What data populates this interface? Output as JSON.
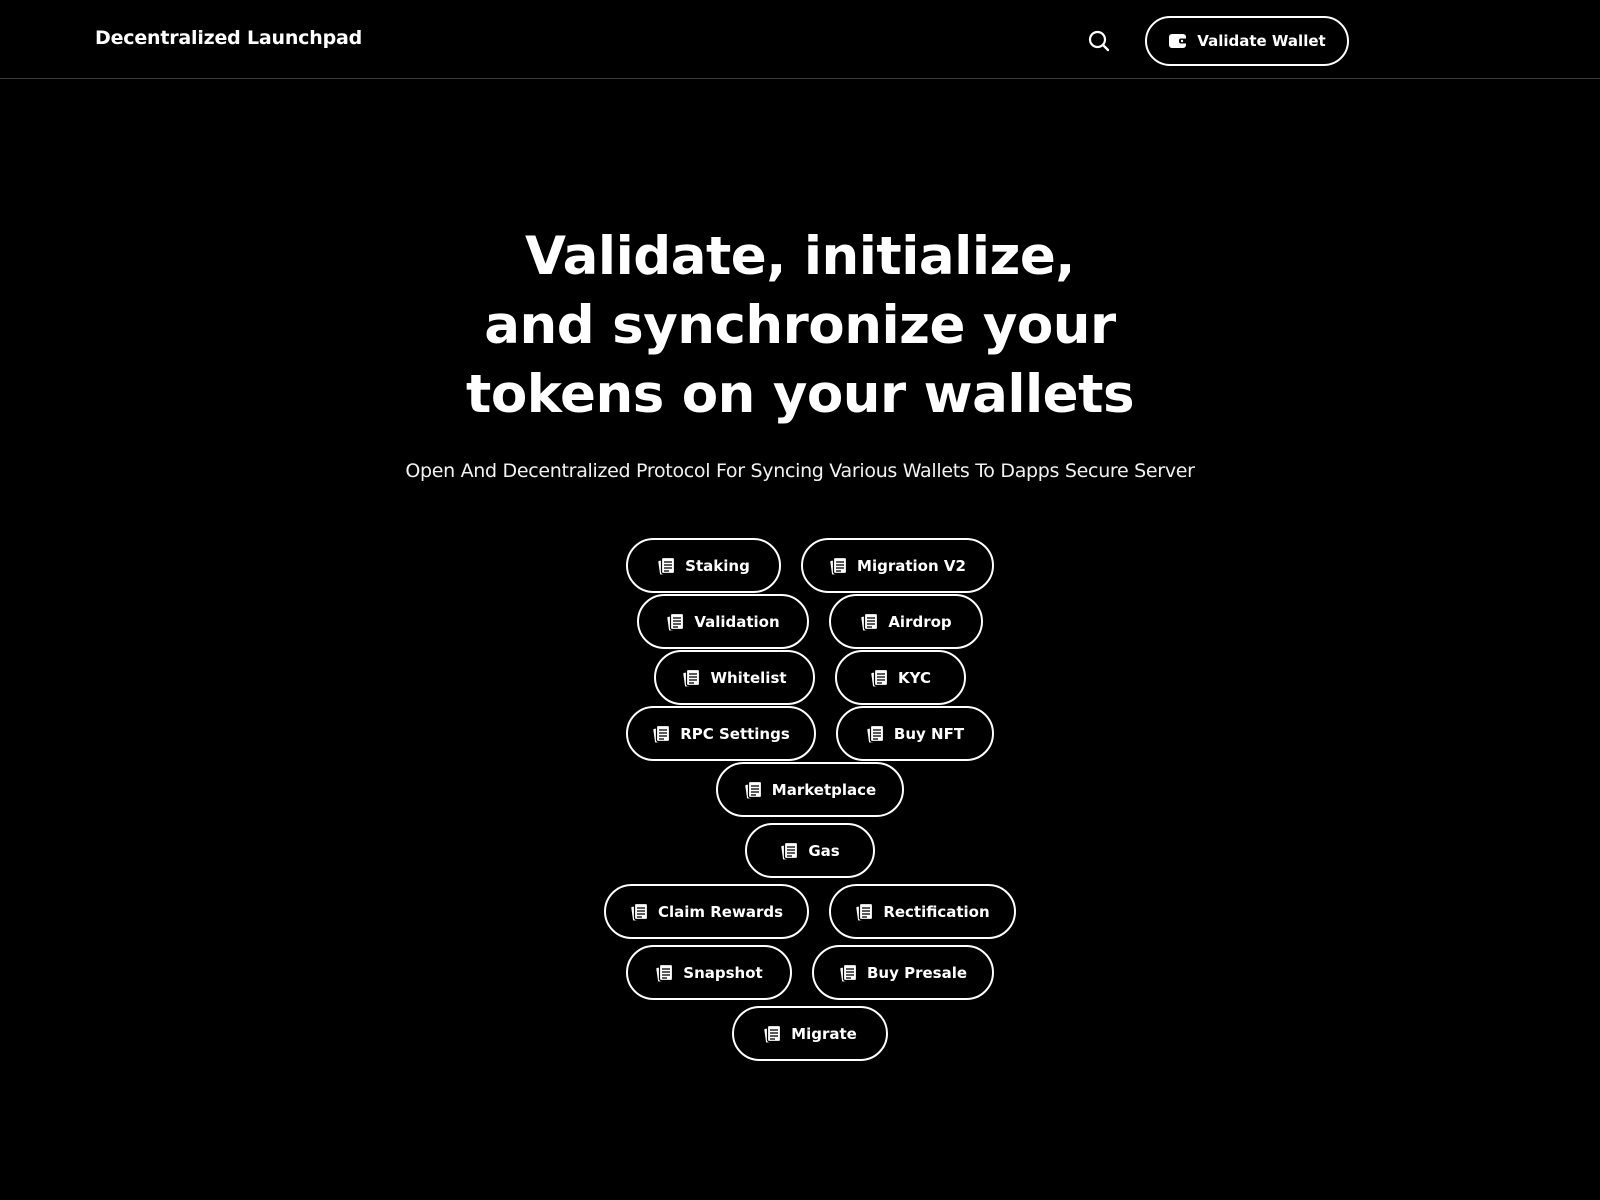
{
  "header": {
    "brand": "Decentralized Launchpad",
    "search_icon": "search-icon",
    "validate_wallet_label": "Validate Wallet",
    "wallet_icon": "wallet-icon"
  },
  "hero": {
    "title_lines": [
      "Validate, initialize,",
      "and synchronize your",
      "tokens on your wallets"
    ],
    "subtitle": "Open And Decentralized Protocol For Syncing Various Wallets To Dapps Secure Server"
  },
  "actions": [
    {
      "label": "Staking",
      "icon": "document-icon"
    },
    {
      "label": "Migration V2",
      "icon": "document-icon"
    },
    {
      "label": "Validation",
      "icon": "document-icon"
    },
    {
      "label": "Airdrop",
      "icon": "document-icon"
    },
    {
      "label": "Whitelist",
      "icon": "document-icon"
    },
    {
      "label": "KYC",
      "icon": "document-icon"
    },
    {
      "label": "RPC Settings",
      "icon": "document-icon"
    },
    {
      "label": "Buy NFT",
      "icon": "document-icon"
    },
    {
      "label": "Marketplace",
      "icon": "document-icon"
    },
    {
      "label": "Gas",
      "icon": "document-icon"
    },
    {
      "label": "Claim Rewards",
      "icon": "document-icon"
    },
    {
      "label": "Rectification",
      "icon": "document-icon"
    },
    {
      "label": "Snapshot",
      "icon": "document-icon"
    },
    {
      "label": "Buy Presale",
      "icon": "document-icon"
    },
    {
      "label": "Migrate",
      "icon": "document-icon"
    }
  ],
  "colors": {
    "background": "#000000",
    "foreground": "#ffffff",
    "divider": "#3a3a3a"
  }
}
